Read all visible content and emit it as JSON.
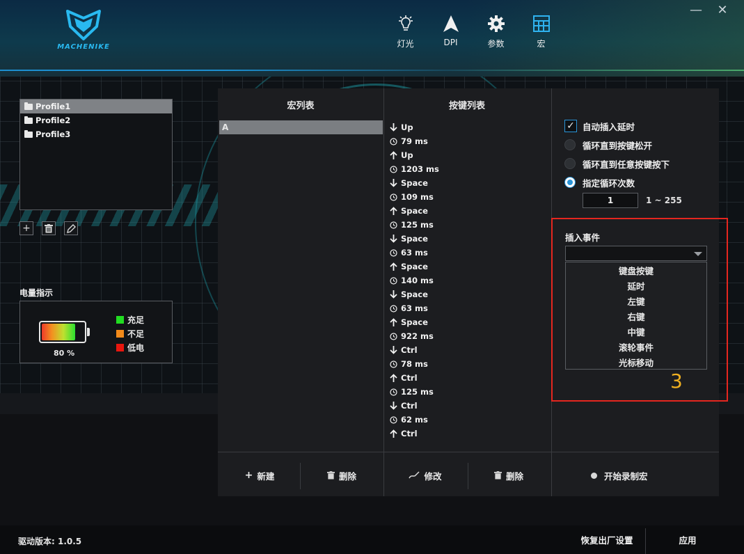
{
  "app": {
    "logo_text": "MACHENIKE",
    "window_controls": {
      "minimize": "—",
      "close": "✕"
    }
  },
  "nav": [
    {
      "label": "灯光",
      "icon": "light-bulb-icon"
    },
    {
      "label": "DPI",
      "icon": "cursor-arrow-icon"
    },
    {
      "label": "参数",
      "icon": "gear-icon"
    },
    {
      "label": "宏",
      "icon": "grid-icon"
    }
  ],
  "profiles": [
    "Profile1",
    "Profile2",
    "Profile3"
  ],
  "profile_tools": {
    "add": "+",
    "delete": "🗑",
    "edit": "✎"
  },
  "battery": {
    "title": "电量指示",
    "percent_text": "80 %",
    "level": 0.8,
    "legend": [
      {
        "label": "充足",
        "color": "#22dd22"
      },
      {
        "label": "不足",
        "color": "#f28a1a"
      },
      {
        "label": "低电",
        "color": "#e8160e"
      }
    ]
  },
  "macro_list": {
    "header": "宏列表",
    "items": [
      "A"
    ]
  },
  "key_list": {
    "header": "按键列表",
    "items": [
      {
        "dir": "down",
        "text": "Up"
      },
      {
        "dir": "delay",
        "text": "79 ms"
      },
      {
        "dir": "up",
        "text": "Up"
      },
      {
        "dir": "delay",
        "text": "1203 ms"
      },
      {
        "dir": "down",
        "text": "Space"
      },
      {
        "dir": "delay",
        "text": "109 ms"
      },
      {
        "dir": "up",
        "text": "Space"
      },
      {
        "dir": "delay",
        "text": "125 ms"
      },
      {
        "dir": "down",
        "text": "Space"
      },
      {
        "dir": "delay",
        "text": "63 ms"
      },
      {
        "dir": "up",
        "text": "Space"
      },
      {
        "dir": "delay",
        "text": "140 ms"
      },
      {
        "dir": "down",
        "text": "Space"
      },
      {
        "dir": "delay",
        "text": "63 ms"
      },
      {
        "dir": "up",
        "text": "Space"
      },
      {
        "dir": "delay",
        "text": "922 ms"
      },
      {
        "dir": "down",
        "text": "Ctrl"
      },
      {
        "dir": "delay",
        "text": "78 ms"
      },
      {
        "dir": "up",
        "text": "Ctrl"
      },
      {
        "dir": "delay",
        "text": "125 ms"
      },
      {
        "dir": "down",
        "text": "Ctrl"
      },
      {
        "dir": "delay",
        "text": "62 ms"
      },
      {
        "dir": "up",
        "text": "Ctrl"
      }
    ]
  },
  "options": {
    "auto_delay": {
      "label": "自动插入延时",
      "checked": true
    },
    "radios": [
      {
        "label": "循环直到按键松开",
        "selected": false
      },
      {
        "label": "循环直到任意按键按下",
        "selected": false
      },
      {
        "label": "指定循环次数",
        "selected": true
      }
    ],
    "loop_count": "1",
    "loop_range": "1 ~ 255"
  },
  "insert_event": {
    "label": "插入事件",
    "selected": "",
    "options": [
      "键盘按键",
      "延时",
      "左键",
      "右键",
      "中键",
      "滚轮事件",
      "光标移动"
    ],
    "annotation": "3"
  },
  "buttons": {
    "new": "新建",
    "delete_macro": "删除",
    "modify": "修改",
    "delete_key": "删除",
    "record": "开始录制宏"
  },
  "footer": {
    "version": "驱动版本: 1.0.5",
    "restore": "恢复出厂设置",
    "apply": "应用"
  },
  "colors": {
    "accent": "#2a95d8",
    "highlight_box": "#e5261f",
    "annotation": "#f0b020"
  }
}
